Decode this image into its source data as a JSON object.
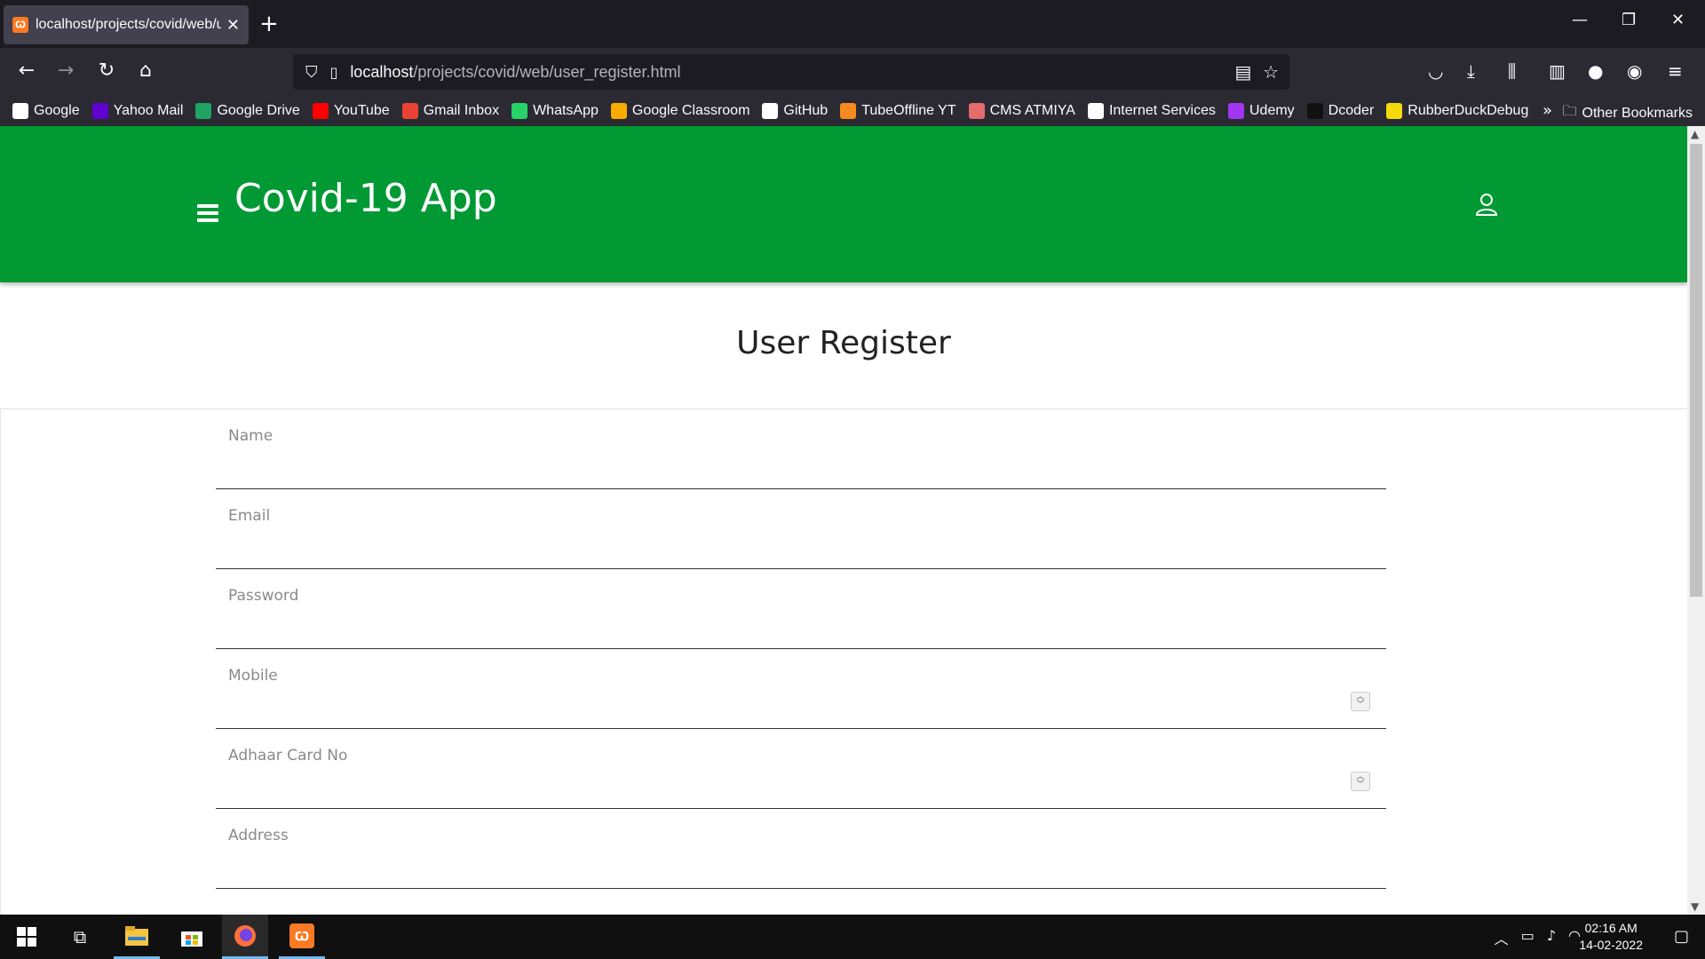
{
  "browser": {
    "tab_title": "localhost/projects/covid/web/user_register.html",
    "url_host": "localhost",
    "url_path": "/projects/covid/web/user_register.html",
    "bookmarks": [
      {
        "label": "Google",
        "icon": "google-icon",
        "color": "#ffffff"
      },
      {
        "label": "Yahoo Mail",
        "icon": "yahoo-icon",
        "color": "#6001d2"
      },
      {
        "label": "Google Drive",
        "icon": "drive-icon",
        "color": "#1fa463"
      },
      {
        "label": "YouTube",
        "icon": "youtube-icon",
        "color": "#ff0000"
      },
      {
        "label": "Gmail Inbox",
        "icon": "gmail-icon",
        "color": "#ea4335"
      },
      {
        "label": "WhatsApp",
        "icon": "whatsapp-icon",
        "color": "#25d366"
      },
      {
        "label": "Google Classroom",
        "icon": "classroom-icon",
        "color": "#f9ab00"
      },
      {
        "label": "GitHub",
        "icon": "github-icon",
        "color": "#ffffff"
      },
      {
        "label": "TubeOffline YT",
        "icon": "tubeoffline-icon",
        "color": "#f68b1f"
      },
      {
        "label": "CMS ATMIYA",
        "icon": "cms-icon",
        "color": "#e56b6f"
      },
      {
        "label": "Internet Services",
        "icon": "globe-icon",
        "color": "#ffffff"
      },
      {
        "label": "Udemy",
        "icon": "udemy-icon",
        "color": "#a435f0"
      },
      {
        "label": "Dcoder",
        "icon": "dcoder-icon",
        "color": "#111111"
      },
      {
        "label": "RubberDuckDebug",
        "icon": "duck-icon",
        "color": "#f5d90a"
      }
    ],
    "other_bookmarks": "Other Bookmarks"
  },
  "app": {
    "title": "Covid-19 App",
    "brand_color": "#009933",
    "page_heading": "User Register",
    "fields": [
      {
        "label": "Name",
        "type": "text"
      },
      {
        "label": "Email",
        "type": "email"
      },
      {
        "label": "Password",
        "type": "password"
      },
      {
        "label": "Mobile",
        "type": "number"
      },
      {
        "label": "Adhaar Card No",
        "type": "number"
      },
      {
        "label": "Address",
        "type": "text"
      }
    ]
  },
  "taskbar": {
    "time": "02:16 AM",
    "date": "14-02-2022"
  }
}
